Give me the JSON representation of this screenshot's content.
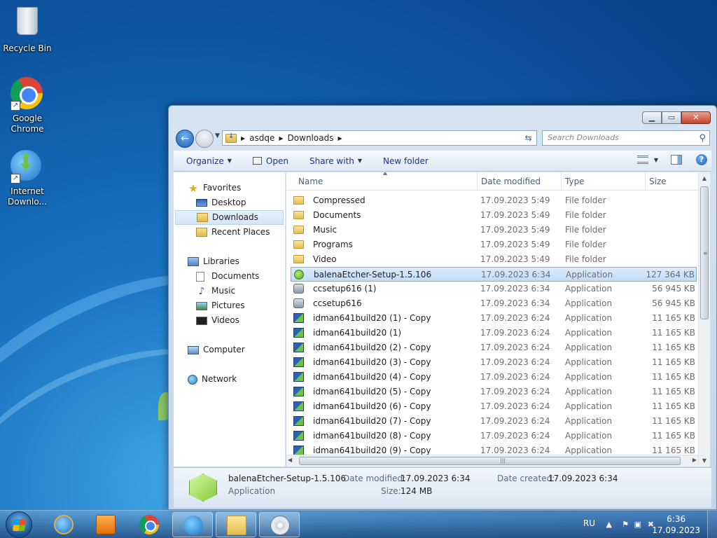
{
  "desktop": {
    "icons": [
      {
        "label": "Recycle Bin"
      },
      {
        "label": "Google Chrome"
      },
      {
        "label": "Internet Downlo..."
      }
    ]
  },
  "window": {
    "address": {
      "segments": [
        "asdqe",
        "Downloads"
      ]
    },
    "search": {
      "placeholder": "Search Downloads"
    },
    "toolbar": {
      "organize": "Organize",
      "open": "Open",
      "share_with": "Share with",
      "new_folder": "New folder"
    },
    "nav": {
      "favorites": "Favorites",
      "desktop": "Desktop",
      "downloads": "Downloads",
      "recent_places": "Recent Places",
      "libraries": "Libraries",
      "documents": "Documents",
      "music": "Music",
      "pictures": "Pictures",
      "videos": "Videos",
      "computer": "Computer",
      "network": "Network"
    },
    "columns": {
      "name": "Name",
      "date": "Date modified",
      "type": "Type",
      "size": "Size"
    },
    "files": [
      {
        "name": "Compressed",
        "date": "17.09.2023 5:49",
        "type": "File folder",
        "size": "",
        "icon": "folder-icon"
      },
      {
        "name": "Documents",
        "date": "17.09.2023 5:49",
        "type": "File folder",
        "size": "",
        "icon": "folder-icon"
      },
      {
        "name": "Music",
        "date": "17.09.2023 5:49",
        "type": "File folder",
        "size": "",
        "icon": "folder-icon"
      },
      {
        "name": "Programs",
        "date": "17.09.2023 5:49",
        "type": "File folder",
        "size": "",
        "icon": "folder-icon"
      },
      {
        "name": "Video",
        "date": "17.09.2023 5:49",
        "type": "File folder",
        "size": "",
        "icon": "folder-icon"
      },
      {
        "name": "balenaEtcher-Setup-1.5.106",
        "date": "17.09.2023 6:34",
        "type": "Application",
        "size": "127 364 KB",
        "icon": "etcher-icon",
        "selected": true
      },
      {
        "name": "ccsetup616 (1)",
        "date": "17.09.2023 6:34",
        "type": "Application",
        "size": "56 945 KB",
        "icon": "ccleaner-icon"
      },
      {
        "name": "ccsetup616",
        "date": "17.09.2023 6:34",
        "type": "Application",
        "size": "56 945 KB",
        "icon": "ccleaner-icon"
      },
      {
        "name": "idman641build20 (1) - Copy",
        "date": "17.09.2023 6:24",
        "type": "Application",
        "size": "11 165 KB",
        "icon": "idm-icon"
      },
      {
        "name": "idman641build20 (1)",
        "date": "17.09.2023 6:24",
        "type": "Application",
        "size": "11 165 KB",
        "icon": "idm-icon"
      },
      {
        "name": "idman641build20 (2) - Copy",
        "date": "17.09.2023 6:24",
        "type": "Application",
        "size": "11 165 KB",
        "icon": "idm-icon"
      },
      {
        "name": "idman641build20 (3) - Copy",
        "date": "17.09.2023 6:24",
        "type": "Application",
        "size": "11 165 KB",
        "icon": "idm-icon"
      },
      {
        "name": "idman641build20 (4) - Copy",
        "date": "17.09.2023 6:24",
        "type": "Application",
        "size": "11 165 KB",
        "icon": "idm-icon"
      },
      {
        "name": "idman641build20 (5) - Copy",
        "date": "17.09.2023 6:24",
        "type": "Application",
        "size": "11 165 KB",
        "icon": "idm-icon"
      },
      {
        "name": "idman641build20 (6) - Copy",
        "date": "17.09.2023 6:24",
        "type": "Application",
        "size": "11 165 KB",
        "icon": "idm-icon"
      },
      {
        "name": "idman641build20 (7) - Copy",
        "date": "17.09.2023 6:24",
        "type": "Application",
        "size": "11 165 KB",
        "icon": "idm-icon"
      },
      {
        "name": "idman641build20 (8) - Copy",
        "date": "17.09.2023 6:24",
        "type": "Application",
        "size": "11 165 KB",
        "icon": "idm-icon"
      },
      {
        "name": "idman641build20 (9) - Copy",
        "date": "17.09.2023 6:24",
        "type": "Application",
        "size": "11 165 KB",
        "icon": "idm-icon"
      }
    ],
    "details": {
      "name": "balenaEtcher-Setup-1.5.106",
      "type": "Application",
      "date_modified_label": "Date modified:",
      "date_modified": "17.09.2023 6:34",
      "date_created_label": "Date created:",
      "date_created": "17.09.2023 6:34",
      "size_label": "Size:",
      "size": "124 MB"
    }
  },
  "taskbar": {
    "language": "RU",
    "time": "6:36",
    "date": "17.09.2023"
  }
}
